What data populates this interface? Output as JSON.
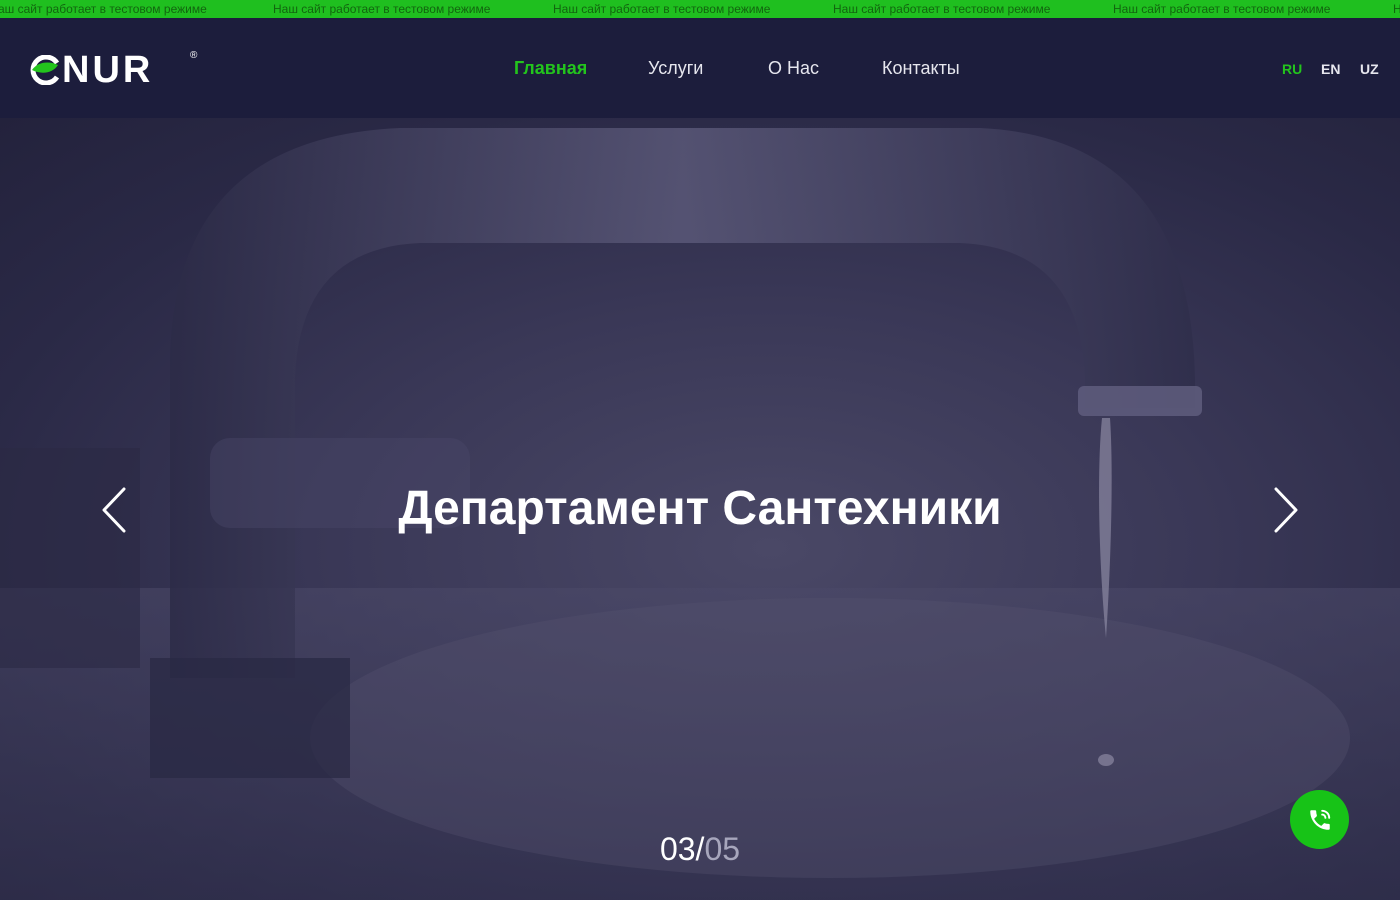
{
  "ticker": {
    "message": "Наш сайт работает в тестовом режиме",
    "message_cut": "аш сайт работает в тестовом режиме",
    "message_edge": "Н"
  },
  "header": {
    "logo_text": "NUR",
    "logo_reg": "®",
    "nav": [
      {
        "label": "Главная",
        "active": true
      },
      {
        "label": "Услуги",
        "active": false
      },
      {
        "label": "О Нас",
        "active": false
      },
      {
        "label": "Контакты",
        "active": false
      }
    ],
    "languages": [
      {
        "label": "RU",
        "active": true
      },
      {
        "label": "EN",
        "active": false
      },
      {
        "label": "UZ",
        "active": false
      }
    ]
  },
  "hero": {
    "title": "Департамент Сантехники",
    "slide_current": "03",
    "slide_separator": "/",
    "slide_total": "05",
    "prev_icon": "chevron-left-icon",
    "next_icon": "chevron-right-icon"
  },
  "call_button": {
    "icon": "phone-call-icon"
  },
  "colors": {
    "accent_green": "#23c41d",
    "ticker_green": "#1fbf1f",
    "header_bg": "#1c1d3c",
    "hero_overlay": "#2a2946"
  }
}
